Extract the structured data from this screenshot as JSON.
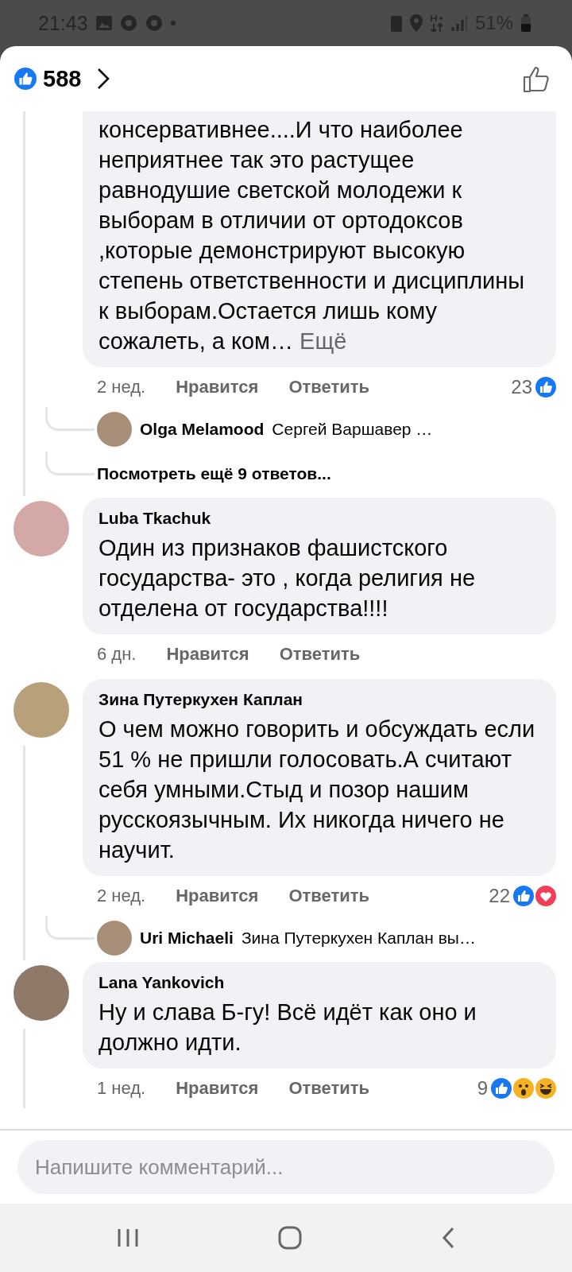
{
  "status_bar": {
    "time": "21:43",
    "battery": "51%"
  },
  "header": {
    "reaction_count": "588"
  },
  "comments": [
    {
      "kind": "comment",
      "text": "консервативнее....И что наиболее неприятнее так это растущее равнодушие светской молодежи к выборам в отличии от ортодоксов ,которые демонстрируют высокую степень ответственности и дисциплины к выборам.Остается лишь кому сожалеть, а ком…",
      "more_link": "Ещё",
      "time": "2 нед.",
      "like": "Нравится",
      "reply": "Ответить",
      "reaction_count": "23",
      "reactions": [
        {
          "kind": "like"
        }
      ],
      "has_replies": true,
      "replies": [
        {
          "kind": "preview",
          "author": "Olga Melamood",
          "text": "Сергей Варшавер …"
        },
        {
          "kind": "more",
          "text": "Посмотреть ещё 9 ответов..."
        }
      ]
    },
    {
      "kind": "comment",
      "author": "Luba Tkachuk",
      "text": "Один из признаков фашистского государства- это , когда религия не отделена от государства!!!!",
      "time": "6 дн.",
      "like": "Нравится",
      "reply": "Ответить",
      "has_replies": false
    },
    {
      "kind": "comment",
      "author": "Зина Путеркухен Каплан",
      "text": "О чем можно говорить и обсуждать если 51 % не пришли голосовать.А считают себя умными.Стыд и позор нашим русскоязычным. Их никогда ничего не научит.",
      "time": "2 нед.",
      "like": "Нравится",
      "reply": "Ответить",
      "reaction_count": "22",
      "reactions": [
        {
          "kind": "like"
        },
        {
          "kind": "love"
        }
      ],
      "has_replies": true,
      "replies": [
        {
          "kind": "preview",
          "author": "Uri Michaeli",
          "text": "Зина Путеркухен Каплан вы…"
        }
      ]
    },
    {
      "kind": "comment",
      "author": "Lana Yankovich",
      "text": "Ну и слава Б-гу!  Всё идёт как оно и должно идти.",
      "time": "1 нед.",
      "like": "Нравится",
      "reply": "Ответить",
      "reaction_count": "9",
      "reactions": [
        {
          "kind": "like"
        },
        {
          "kind": "wow"
        },
        {
          "kind": "haha"
        }
      ],
      "has_replies": true
    }
  ],
  "composer": {
    "placeholder": "Напишите комментарий..."
  }
}
